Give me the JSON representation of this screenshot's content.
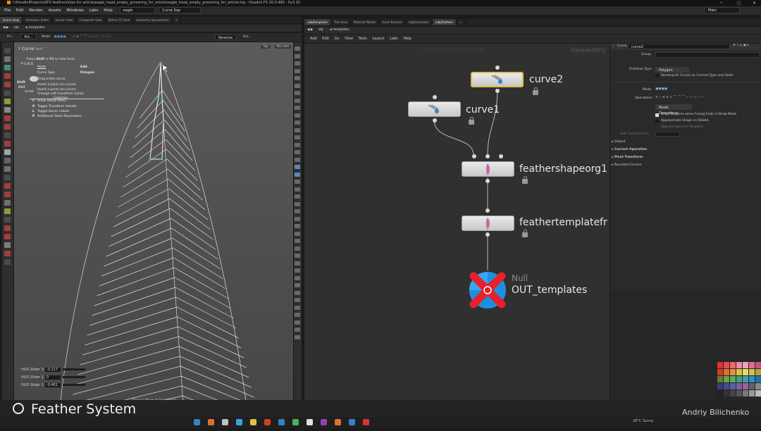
{
  "window": {
    "title": "I:\\HoudiniProjects\\SFX feathers\\hips for article\\eagle_head_empty_grooming_for_article\\eagle_head_empty_grooming_for_article.hip - Houdini FX 20.0.485 - Py3.10"
  },
  "menubar": {
    "items": [
      "File",
      "Edit",
      "Render",
      "Assets",
      "Windows",
      "Labs",
      "Help"
    ],
    "desktop": "eagle",
    "shelf": "Curve Sop",
    "workspace": "Main"
  },
  "left_pane": {
    "tabs": [
      "Scene View",
      "Animation Editor",
      "Render View",
      "Composite View",
      "Motion FX View",
      "Geometry Spreadsheet"
    ],
    "path": [
      "obj",
      "templates"
    ],
    "toolbar": {
      "state": "Pri...",
      "select": "Pol...",
      "mode_label": "Mode",
      "reverse": "Reverse",
      "sel": "Sel..."
    },
    "view_top": "Top",
    "view_cam": "No cam",
    "curve_tool": {
      "title": "Curve",
      "title_suffix": "tool",
      "hotkey_hint_pre": "Press",
      "hotkey_key": "Shift + F1",
      "hotkey_hint_post": "to hide hints",
      "keys": "P G N D",
      "mode_label": "Mode",
      "mode_value": "Edit",
      "curvetype_label": "Curve Type",
      "curvetype_value": "Polygon",
      "actions": [
        {
          "mod": "",
          "text": "Drag entire curve"
        },
        {
          "mod": "Shift",
          "text": "Insert a point (on curve)"
        },
        {
          "mod": "Ctrl",
          "text": "Insert a point (on curve)"
        },
        {
          "mod": "Scroll",
          "text": "Change soft transform radius"
        }
      ],
      "common": "Common",
      "hotkeys": [
        {
          "key": "C",
          "text": "Show Radial Menu"
        },
        {
          "key": "K",
          "text": "Toggle Transform Handle"
        },
        {
          "key": "L",
          "text": "Toggle Hover Labels"
        },
        {
          "key": "P",
          "text": "Additional State Parameters"
        }
      ]
    },
    "hud": [
      {
        "label": "HUD Slider 3",
        "value": "-0.217"
      },
      {
        "label": "HUD Slider 2",
        "value": "0"
      },
      {
        "label": "HUD Slider 1",
        "value": "-0.461"
      }
    ],
    "status_hint": "Drag to Move Anchor Points"
  },
  "right_pane": {
    "tabs": [
      "/obj/templates",
      "Tree View",
      "Material Palette",
      "Asset Browser",
      "/obj/templates",
      "/obj/feathers"
    ],
    "path": [
      "obj",
      "templates"
    ],
    "menu": [
      "Add",
      "Edit",
      "Go",
      "View",
      "Tools",
      "Layout",
      "Labs",
      "Help"
    ],
    "watermark": "CONFIDENTIAL H20.0.485",
    "context": "Geometry",
    "nodes": [
      {
        "name": "curve2",
        "selected": true
      },
      {
        "name": "curve1",
        "selected": false
      },
      {
        "name": "feathershapeorg1",
        "selected": false
      },
      {
        "name": "feathertemplatefr",
        "selected": false
      },
      {
        "name": "OUT_templates",
        "type": "Null"
      }
    ]
  },
  "params": {
    "op_type": "Curve",
    "op_name": "curve2",
    "group_label": "Group",
    "primtype_label": "Primitive Type",
    "primtype_value": "Polygon",
    "reinterpret": "Reinterpret Curves as Current Type and Order",
    "mode_label": "Mode",
    "operations_label": "Operations",
    "reset_ops": "Reset Operations",
    "snap_tangents": "Snap Tangents when Fusing Ends in Draw Mode",
    "approx_shape": "Approximate Shape on Delete",
    "approx_end": "Approximate End Tangents",
    "soft_transform": "Soft Transform Ra...",
    "sections": [
      "Output",
      "Current Operation",
      "Pivot Transform",
      "Rounded Corners"
    ]
  },
  "footer": {
    "brand": "Feather System",
    "author": "Andriy Bilichenko",
    "tray_temp": "28°C",
    "tray_text": "Sunny"
  },
  "colors": {
    "houdini_orange": "#ff8c1a",
    "selected_node": "#e1c04a",
    "null_red": "#e8202a",
    "null_blue": "#1e8fe0",
    "viewport_grid": "#d9d9d9",
    "curve_handle": "#39c6b0"
  }
}
